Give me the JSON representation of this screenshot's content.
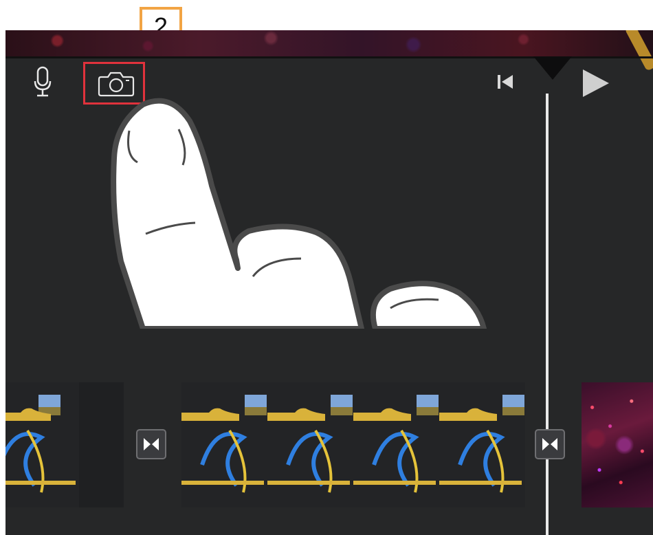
{
  "step_badge": {
    "number": "2"
  },
  "toolbar": {
    "mic_icon": "microphone-icon",
    "camera_icon": "camera-icon",
    "skip_icon": "skip-to-start-icon",
    "play_icon": "play-icon"
  },
  "colors": {
    "background": "#262728",
    "highlight_box": "#e0323c",
    "badge_border": "#f2a444",
    "playhead": "#e9e9e9"
  },
  "timeline": {
    "clips": [
      {
        "name": "clip-a",
        "frames": 1
      },
      {
        "name": "clip-b",
        "frames": 4
      },
      {
        "name": "clip-c",
        "frames": 1
      }
    ],
    "transitions": [
      "transition-icon",
      "transition-icon"
    ]
  }
}
